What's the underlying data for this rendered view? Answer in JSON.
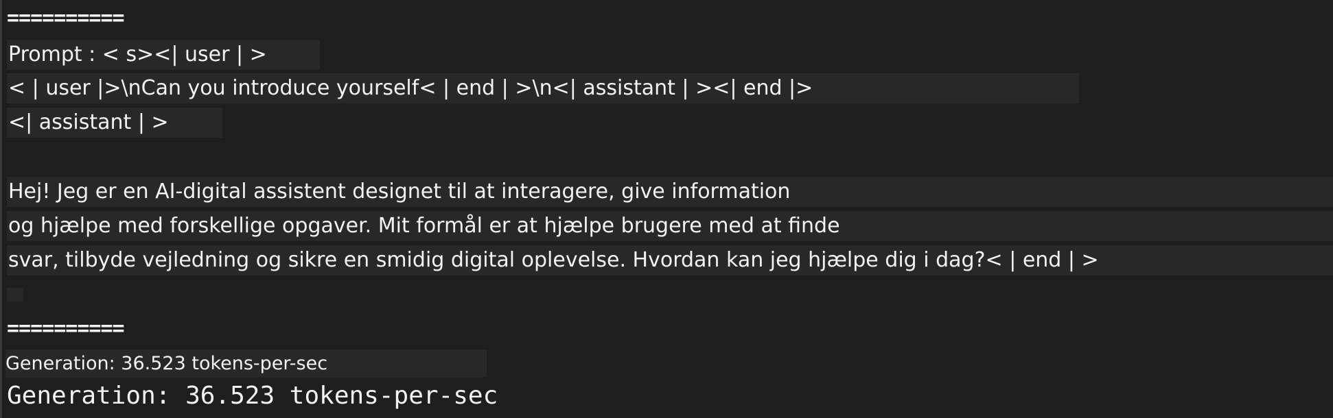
{
  "terminal": {
    "separator_top": "==========",
    "prompt_line1": "Prompt : < s><| user | >",
    "prompt_line2": "< | user |>\\nCan you introduce yourself< | end | >\\n<| assistant | ><| end |>",
    "prompt_line3": "<| assistant | >",
    "response_lines": [
      "Hej! Jeg er en AI-digital assistent designet til at interagere, give information",
      "og hjælpe med forskellige opgaver. Mit formål er at hjælpe brugere med at finde",
      "svar, tilbyde vejledning og sikre en smidig digital oplevelse. Hvordan kan jeg hjælpe dig i dag?< | end | >"
    ],
    "separator_bottom": "==========",
    "generation_small": "Generation: 36.523 tokens-per-sec",
    "generation_mono": "Generation: 36.523 tokens-per-sec"
  }
}
